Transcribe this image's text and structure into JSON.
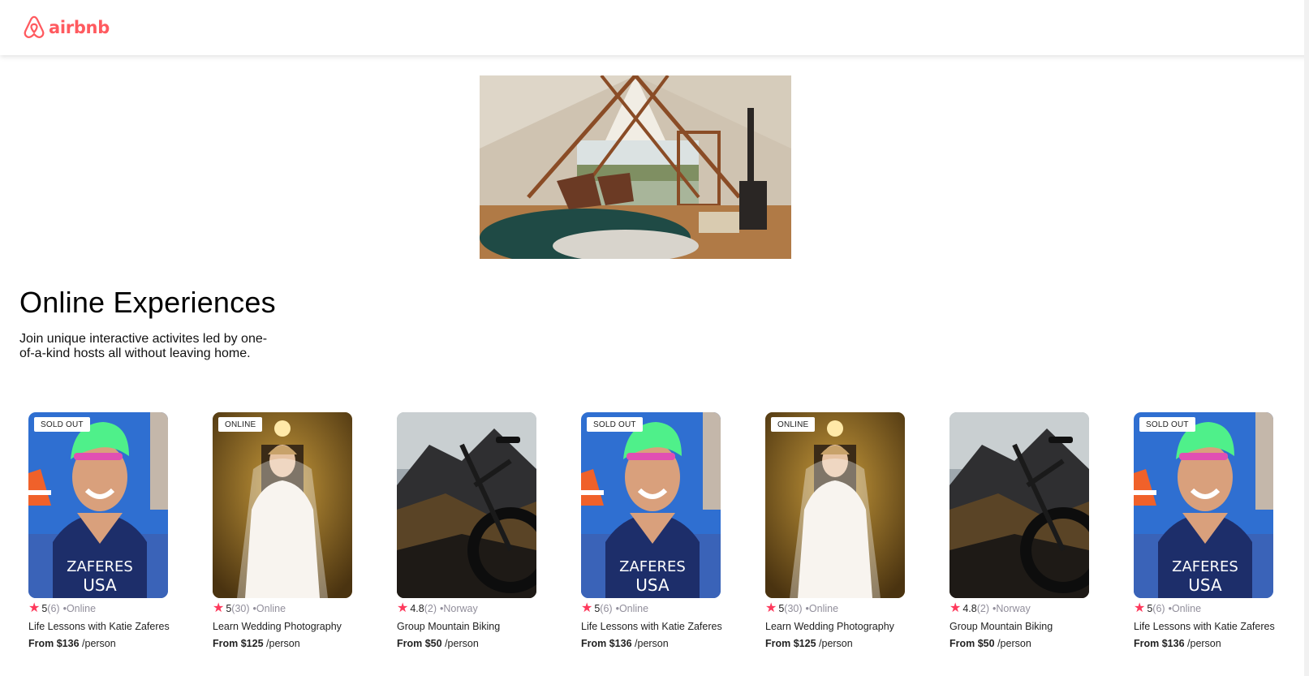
{
  "brand": {
    "name": "airbnb",
    "color": "#FF5A5F"
  },
  "hero": {
    "alt": "Cabin loft interior",
    "icon": "cabin-photo"
  },
  "intro": {
    "title": "Online Experiences",
    "subtitle": "Join unique interactive activites led by one-of-a-kind hosts all without leaving home."
  },
  "colors": {
    "star": "#FE395C",
    "muted": "#918E9B"
  },
  "cards": [
    {
      "badge": "SOLD OUT",
      "rating": "5",
      "count": "(6)",
      "location": "•Online",
      "title": "Life Lessons with Katie Zaferes",
      "price": "From $136",
      "unit": "/person",
      "photo": "swimmer-photo"
    },
    {
      "badge": "ONLINE",
      "rating": "5",
      "count": "(30)",
      "location": "•Online",
      "title": "Learn Wedding Photography",
      "price": "From $125",
      "unit": "/person",
      "photo": "bride-photo"
    },
    {
      "badge": "",
      "rating": "4.8",
      "count": "(2)",
      "location": "•Norway",
      "title": "Group Mountain Biking",
      "price": "From $50",
      "unit": "/person",
      "photo": "bike-photo"
    },
    {
      "badge": "SOLD OUT",
      "rating": "5",
      "count": "(6)",
      "location": "•Online",
      "title": "Life Lessons with Katie Zaferes",
      "price": "From $136",
      "unit": "/person",
      "photo": "swimmer-photo"
    },
    {
      "badge": "ONLINE",
      "rating": "5",
      "count": "(30)",
      "location": "•Online",
      "title": "Learn Wedding Photography",
      "price": "From $125",
      "unit": "/person",
      "photo": "bride-photo"
    },
    {
      "badge": "",
      "rating": "4.8",
      "count": "(2)",
      "location": "•Norway",
      "title": "Group Mountain Biking",
      "price": "From $50",
      "unit": "/person",
      "photo": "bike-photo"
    },
    {
      "badge": "SOLD OUT",
      "rating": "5",
      "count": "(6)",
      "location": "•Online",
      "title": "Life Lessons with Katie Zaferes",
      "price": "From $136",
      "unit": "/person",
      "photo": "swimmer-photo"
    }
  ]
}
